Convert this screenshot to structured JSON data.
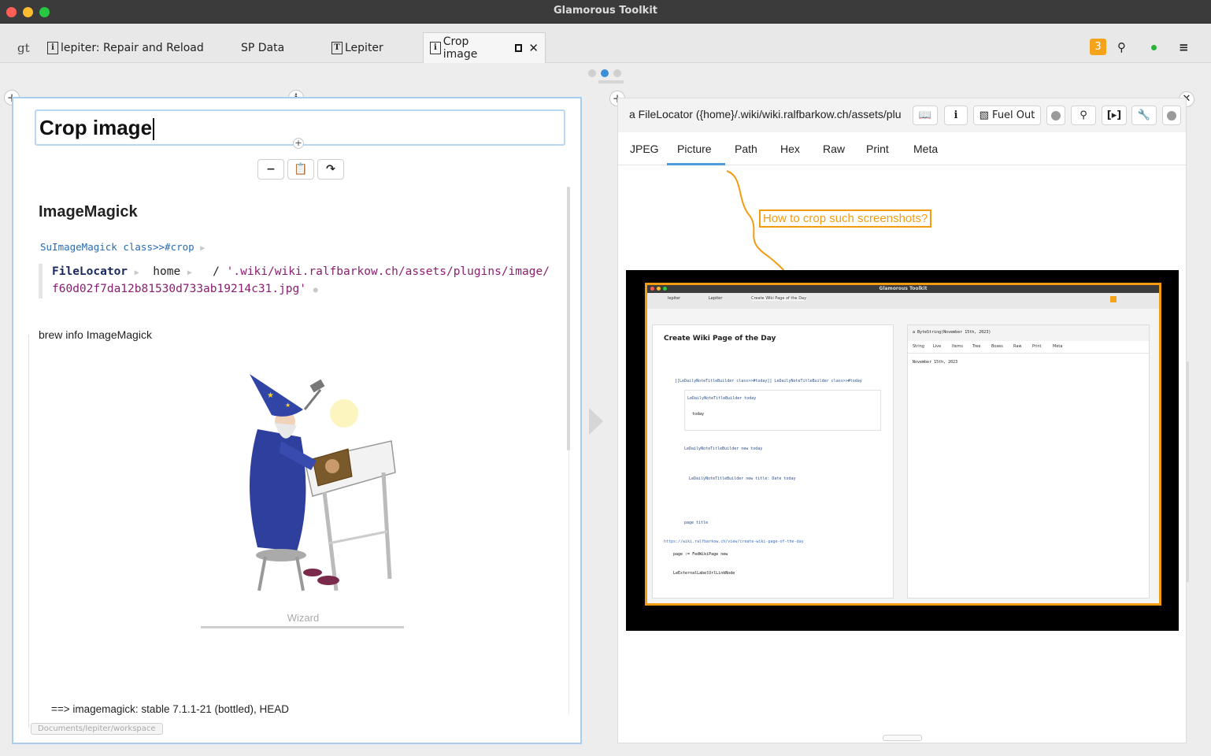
{
  "window": {
    "title": "Glamorous Toolkit"
  },
  "tabs": [
    {
      "label": "lepiter: Repair and Reload"
    },
    {
      "label": "SP Data"
    },
    {
      "label": "Lepiter"
    },
    {
      "label": "Crop image"
    }
  ],
  "top_right": {
    "notification_count": "3"
  },
  "left_page": {
    "title": "Crop image",
    "heading": "ImageMagick",
    "code_link": "SuImageMagick class>>#crop",
    "code": {
      "class_name": "FileLocator",
      "home": "home",
      "slash": "/",
      "path_line1": "'.wiki/wiki.ralfbarkow.ch/assets/plugins/image/",
      "path_line2": "f60d02f7da12b81530d733ab19214c31.jpg'"
    },
    "brew_text": "brew info ImageMagick",
    "image_caption": "Wizard",
    "output_text": "==> imagemagick: stable 7.1.1-21 (bottled), HEAD",
    "workspace_path": "Documents/lepiter/workspace"
  },
  "right_page": {
    "title": "a FileLocator ({home}/.wiki/wiki.ralfbarkow.ch/assets/plu",
    "fuel_out_label": "Fuel Out",
    "view_tabs": [
      "JPEG",
      "Picture",
      "Path",
      "Hex",
      "Raw",
      "Print",
      "Meta"
    ],
    "selected_tab": "Picture",
    "callout_text": "How to crop such screenshots?",
    "screenshot": {
      "window_title": "Glamorous Toolkit",
      "tabs": [
        "lepiter",
        "Lepiter",
        "Create Wiki Page of the Day"
      ],
      "page_title": "Create Wiki Page of the Day",
      "code_lines": [
        "[[LeDailyNoteTitleBuilder class>>#today]] LeDailyNoteTitleBuilder class>>#today",
        "LeDailyNoteTitleBuilder today",
        "today",
        "LeDailyNoteTitleBuilder new today",
        "LeDailyNoteTitleBuilder new title: Date today",
        "page title",
        "https://wiki.ralfbarkow.ch/view/create-wiki-page-of-the-day",
        "page := FedWikiPage new",
        "LeExternalLabelUrlLinkNode"
      ],
      "right_title": "a ByteString(November 15th, 2023)",
      "right_tabs": [
        "String",
        "Live",
        "Items",
        "Tree",
        "Boxes",
        "Raw",
        "Print",
        "Meta"
      ],
      "right_value": "November 15th, 2023"
    }
  }
}
